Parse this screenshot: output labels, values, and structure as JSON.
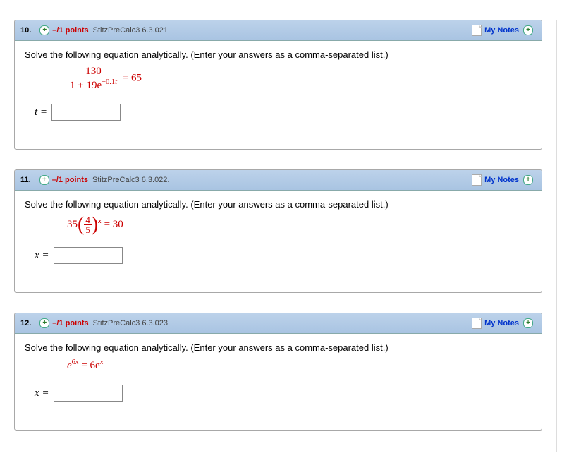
{
  "common": {
    "mynotes_label": "My Notes",
    "instruction": "Solve the following equation analytically. (Enter your answers as a comma-separated list.)"
  },
  "q10": {
    "number": "10.",
    "points": "–/1 points",
    "source": "StitzPreCalc3 6.3.021.",
    "eq_num": "130",
    "eq_den_prefix": "1 + 19e",
    "eq_den_exp": "−0.1",
    "eq_den_expvar": "t",
    "eq_rhs": " = 65",
    "var_label": "t ="
  },
  "q11": {
    "number": "11.",
    "points": "–/1 points",
    "source": "StitzPreCalc3 6.3.022.",
    "coeff": "35",
    "frac_n": "4",
    "frac_d": "5",
    "exp_var": "x",
    "eq_rhs": " = 30",
    "var_label": "x ="
  },
  "q12": {
    "number": "12.",
    "points": "–/1 points",
    "source": "StitzPreCalc3 6.3.023.",
    "lhs_base": "e",
    "lhs_exp_coeff": "6",
    "lhs_exp_var": "x",
    "eq_mid": " = 6e",
    "rhs_exp_var": "x",
    "var_label": "x ="
  }
}
